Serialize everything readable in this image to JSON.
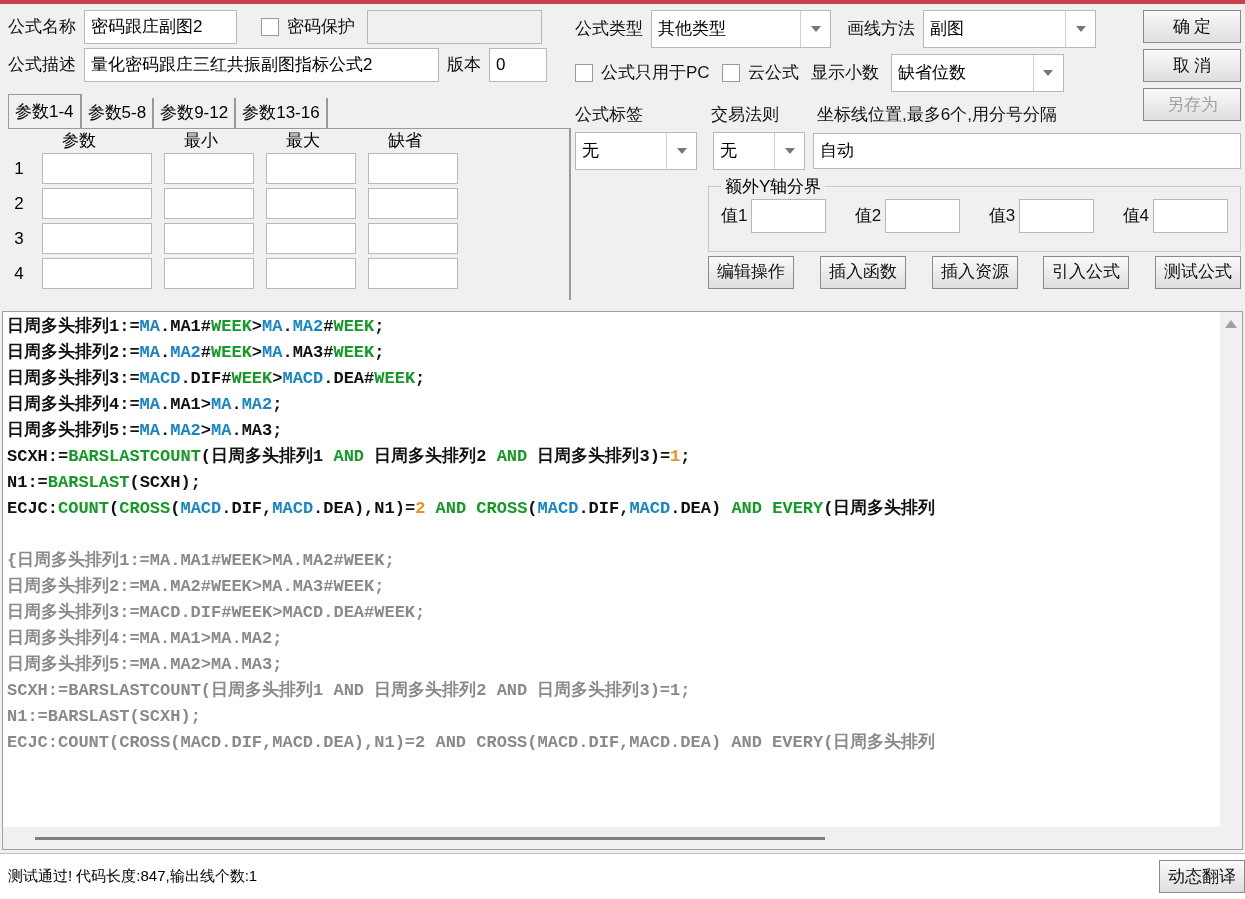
{
  "form": {
    "name_label": "公式名称",
    "name": "密码跟庄副图2",
    "password": {
      "label": "密码保护",
      "checked": false
    },
    "desc_label": "公式描述",
    "description": "量化密码跟庄三红共振副图指标公式2",
    "version_label": "版本",
    "version": "0"
  },
  "param_tabs": [
    {
      "label": "参数1-4",
      "selected": true
    },
    {
      "label": "参数5-8",
      "selected": false
    },
    {
      "label": "参数9-12",
      "selected": false
    },
    {
      "label": "参数13-16",
      "selected": false
    }
  ],
  "param_table": {
    "columns": [
      "参数",
      "最小",
      "最大",
      "缺省"
    ],
    "rows": [
      "1",
      "2",
      "3",
      "4"
    ]
  },
  "formula_type": {
    "label": "公式类型",
    "value": "其他类型"
  },
  "draw_method": {
    "label": "画线方法",
    "value": "副图"
  },
  "pc_only": {
    "label": "公式只用于PC",
    "checked": false
  },
  "cloud": {
    "label": "云公式",
    "checked": false
  },
  "decimals": {
    "label": "显示小数",
    "value": "缺省位数"
  },
  "actions": [
    {
      "label": "确 定",
      "disabled": false
    },
    {
      "label": "取 消",
      "disabled": false
    },
    {
      "label": "另存为",
      "disabled": true
    }
  ],
  "tag": {
    "label": "公式标签",
    "value": "无"
  },
  "trade_rule": {
    "label": "交易法则",
    "value": "无"
  },
  "axis_lines": {
    "label": "坐标线位置,最多6个,用分号分隔",
    "value": "自动"
  },
  "y_bounds": {
    "title": "额外Y轴分界",
    "fields": [
      "值1",
      "值2",
      "值3",
      "值4"
    ]
  },
  "tools": [
    "编辑操作",
    "插入函数",
    "插入资源",
    "引入公式",
    "测试公式"
  ],
  "code": [
    {
      "commented": false,
      "lines": [
        [
          {
            "kind": "plain",
            "text": "日周多头排列1:="
          },
          {
            "kind": "ref",
            "text": "MA"
          },
          {
            "kind": "plain",
            "text": ".MA1#"
          },
          {
            "kind": "keyword",
            "text": "WEEK"
          },
          {
            "kind": "plain",
            "text": ">"
          },
          {
            "kind": "ref",
            "text": "MA"
          },
          {
            "kind": "plain",
            "text": "."
          },
          {
            "kind": "ref",
            "text": "MA2"
          },
          {
            "kind": "plain",
            "text": "#"
          },
          {
            "kind": "keyword",
            "text": "WEEK"
          },
          {
            "kind": "plain",
            "text": ";"
          }
        ],
        [
          {
            "kind": "plain",
            "text": "日周多头排列2:="
          },
          {
            "kind": "ref",
            "text": "MA"
          },
          {
            "kind": "plain",
            "text": "."
          },
          {
            "kind": "ref",
            "text": "MA2"
          },
          {
            "kind": "plain",
            "text": "#"
          },
          {
            "kind": "keyword",
            "text": "WEEK"
          },
          {
            "kind": "plain",
            "text": ">"
          },
          {
            "kind": "ref",
            "text": "MA"
          },
          {
            "kind": "plain",
            "text": ".MA3#"
          },
          {
            "kind": "keyword",
            "text": "WEEK"
          },
          {
            "kind": "plain",
            "text": ";"
          }
        ],
        [
          {
            "kind": "plain",
            "text": "日周多头排列3:="
          },
          {
            "kind": "ref",
            "text": "MACD"
          },
          {
            "kind": "plain",
            "text": ".DIF#"
          },
          {
            "kind": "keyword",
            "text": "WEEK"
          },
          {
            "kind": "plain",
            "text": ">"
          },
          {
            "kind": "ref",
            "text": "MACD"
          },
          {
            "kind": "plain",
            "text": ".DEA#"
          },
          {
            "kind": "keyword",
            "text": "WEEK"
          },
          {
            "kind": "plain",
            "text": ";"
          }
        ],
        [
          {
            "kind": "plain",
            "text": "日周多头排列4:="
          },
          {
            "kind": "ref",
            "text": "MA"
          },
          {
            "kind": "plain",
            "text": ".MA1>"
          },
          {
            "kind": "ref",
            "text": "MA"
          },
          {
            "kind": "plain",
            "text": "."
          },
          {
            "kind": "ref",
            "text": "MA2"
          },
          {
            "kind": "plain",
            "text": ";"
          }
        ],
        [
          {
            "kind": "plain",
            "text": "日周多头排列5:="
          },
          {
            "kind": "ref",
            "text": "MA"
          },
          {
            "kind": "plain",
            "text": "."
          },
          {
            "kind": "ref",
            "text": "MA2"
          },
          {
            "kind": "plain",
            "text": ">"
          },
          {
            "kind": "ref",
            "text": "MA"
          },
          {
            "kind": "plain",
            "text": ".MA3;"
          }
        ],
        [
          {
            "kind": "plain",
            "text": "SCXH:="
          },
          {
            "kind": "keyword",
            "text": "BARSLASTCOUNT"
          },
          {
            "kind": "plain",
            "text": "(日周多头排列1 "
          },
          {
            "kind": "keyword",
            "text": "AND"
          },
          {
            "kind": "plain",
            "text": " 日周多头排列2 "
          },
          {
            "kind": "keyword",
            "text": "AND"
          },
          {
            "kind": "plain",
            "text": " 日周多头排列3)="
          },
          {
            "kind": "number",
            "text": "1"
          },
          {
            "kind": "plain",
            "text": ";"
          }
        ],
        [
          {
            "kind": "plain",
            "text": "N1:="
          },
          {
            "kind": "keyword",
            "text": "BARSLAST"
          },
          {
            "kind": "plain",
            "text": "(SCXH);"
          }
        ],
        [
          {
            "kind": "plain",
            "text": "ECJC:"
          },
          {
            "kind": "keyword",
            "text": "COUNT"
          },
          {
            "kind": "plain",
            "text": "("
          },
          {
            "kind": "keyword",
            "text": "CROSS"
          },
          {
            "kind": "plain",
            "text": "("
          },
          {
            "kind": "ref",
            "text": "MACD"
          },
          {
            "kind": "plain",
            "text": ".DIF,"
          },
          {
            "kind": "ref",
            "text": "MACD"
          },
          {
            "kind": "plain",
            "text": ".DEA),N1)="
          },
          {
            "kind": "number",
            "text": "2"
          },
          {
            "kind": "keyword",
            "text": " AND CROSS"
          },
          {
            "kind": "plain",
            "text": "("
          },
          {
            "kind": "ref",
            "text": "MACD"
          },
          {
            "kind": "plain",
            "text": ".DIF,"
          },
          {
            "kind": "ref",
            "text": "MACD"
          },
          {
            "kind": "plain",
            "text": ".DEA) "
          },
          {
            "kind": "keyword",
            "text": "AND EVERY"
          },
          {
            "kind": "plain",
            "text": "(日周多头排列"
          }
        ]
      ]
    },
    {
      "commented": true,
      "lines": [
        [
          {
            "text": "{日周多头排列1:=MA.MA1#WEEK>MA.MA2#WEEK;"
          }
        ],
        [
          {
            "text": "日周多头排列2:=MA.MA2#WEEK>MA.MA3#WEEK;"
          }
        ],
        [
          {
            "text": "日周多头排列3:=MACD.DIF#WEEK>MACD.DEA#WEEK;"
          }
        ],
        [
          {
            "text": "日周多头排列4:=MA.MA1>MA.MA2;"
          }
        ],
        [
          {
            "text": "日周多头排列5:=MA.MA2>MA.MA3;"
          }
        ],
        [
          {
            "text": "SCXH:=BARSLASTCOUNT(日周多头排列1 AND 日周多头排列2 AND 日周多头排列3)=1;"
          }
        ],
        [
          {
            "text": "N1:=BARSLAST(SCXH);"
          }
        ],
        [
          {
            "text": "ECJC:COUNT(CROSS(MACD.DIF,MACD.DEA),N1)=2 AND CROSS(MACD.DIF,MACD.DEA) AND EVERY(日周多头排列"
          }
        ]
      ]
    }
  ],
  "status_bar": {
    "message": "测试通过! 代码长度:847,输出线个数:1",
    "button": "动态翻译"
  }
}
